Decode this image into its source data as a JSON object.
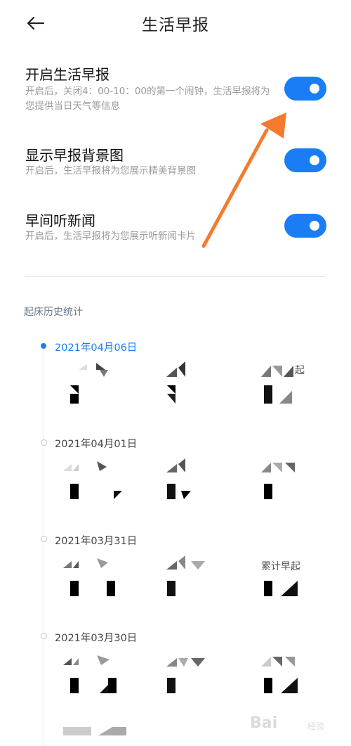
{
  "header": {
    "title": "生活早报",
    "back_icon": "arrow-left-icon"
  },
  "settings": [
    {
      "title": "开启生活早报",
      "desc": "开启后，关闭4：00-10：00的第一个闹钟，生活早报将为您提供当日天气等信息",
      "enabled": true
    },
    {
      "title": "显示早报背景图",
      "desc": "开启后，生活早报将为您展示精美背景图",
      "enabled": true
    },
    {
      "title": "早间听新闻",
      "desc": "开启后，生活早报将为您展示听新闻卡片",
      "enabled": true
    }
  ],
  "history": {
    "section_title": "起床历史统计",
    "entries": [
      {
        "date": "2021年04月06日",
        "active": true,
        "side_label": "起"
      },
      {
        "date": "2021年04月01日",
        "active": false,
        "side_label": ""
      },
      {
        "date": "2021年03月31日",
        "active": false,
        "side_label": "累计早起"
      },
      {
        "date": "2021年03月30日",
        "active": false,
        "side_label": ""
      }
    ]
  },
  "watermark": {
    "text": "Bai",
    "small": "经验"
  },
  "colors": {
    "accent": "#1a7df5",
    "annotation_arrow": "#f47a30"
  }
}
